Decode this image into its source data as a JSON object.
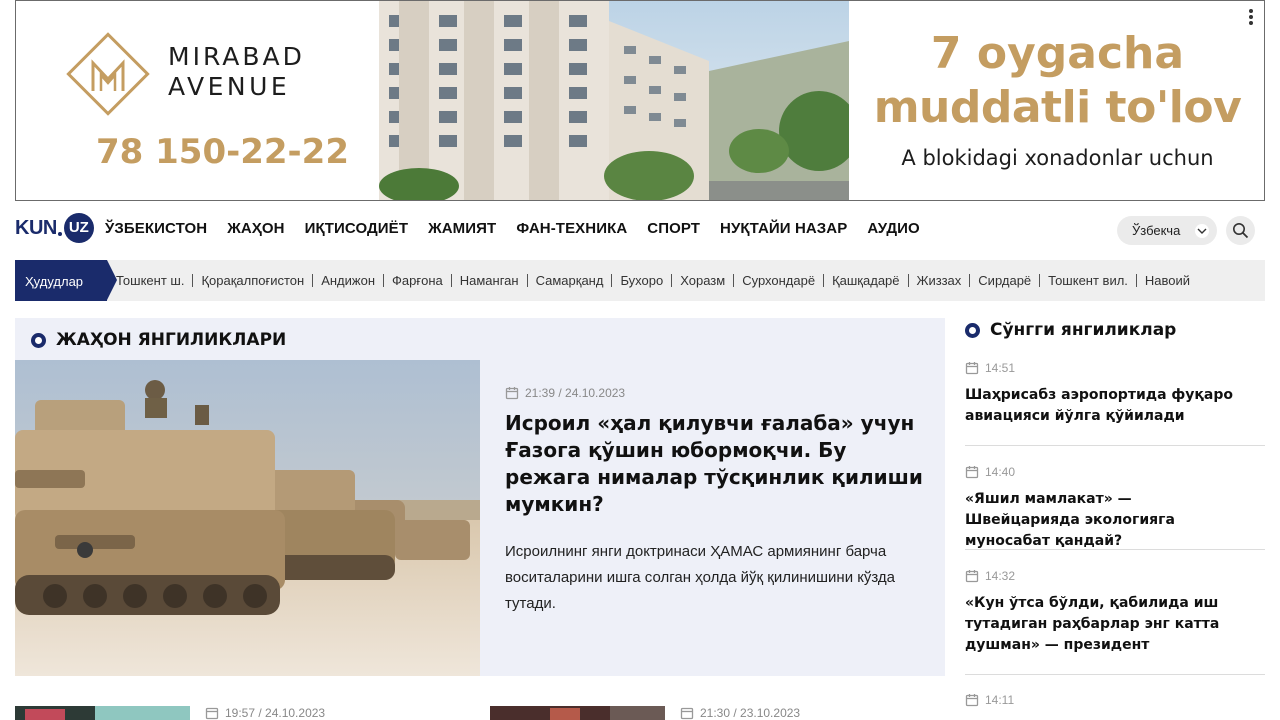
{
  "banner": {
    "brand_line1": "MIRABAD",
    "brand_line2": "AVENUE",
    "phone": "78 150-22-22",
    "promo_line1": "7 oygacha",
    "promo_line2": "muddatli to'lov",
    "promo_line3": "A blokidagi xonadonlar uchun"
  },
  "header": {
    "logo_kun": "KUN",
    "logo_uz": "UZ",
    "nav": [
      "ЎЗБЕКИСТОН",
      "ЖАҲОН",
      "ИҚТИСОДИЁТ",
      "ЖАМИЯТ",
      "ФАН-ТЕХНИКА",
      "СПОРТ",
      "НУҚТАЙИ НАЗАР",
      "АУДИО"
    ],
    "language": "Ўзбекча"
  },
  "regions": {
    "tab_label": "Ҳудудлар",
    "items": [
      "Тошкент ш.",
      "Қорақалпоғистон",
      "Андижон",
      "Фарғона",
      "Наманган",
      "Самарқанд",
      "Бухоро",
      "Хоразм",
      "Сурхондарё",
      "Қашқадарё",
      "Жиззах",
      "Сирдарё",
      "Тошкент вил.",
      "Навоий"
    ]
  },
  "world": {
    "heading": "ЖАҲОН ЯНГИЛИКЛАРИ",
    "featured": {
      "datetime": "21:39 / 24.10.2023",
      "title": "Исроил «ҳал қилувчи ғалаба» учун Ғазога қўшин юбормоқчи. Бу режага нималар тўсқинлик қилиши мумкин?",
      "excerpt": "Исроилнинг янги доктринаси ҲАМАС армиянинг барча воситаларини ишга солган ҳолда йўқ қилинишини кўзда тутади."
    },
    "cards": [
      {
        "datetime": "19:57 / 24.10.2023"
      },
      {
        "datetime": "21:30 / 23.10.2023"
      }
    ]
  },
  "latest": {
    "heading": "Сўнгги янгиликлар",
    "items": [
      {
        "time": "14:51",
        "title": "Шаҳрисабз аэропортида фуқаро авиацияси йўлга қўйилади"
      },
      {
        "time": "14:40",
        "title": "«Яшил мамлакат» — Швейцарияда экологияга муносабат қандай?"
      },
      {
        "time": "14:32",
        "title": "«Кун ўтса бўлди, қабилида иш тутадиган раҳбарлар энг катта душман» — президент"
      },
      {
        "time": "14:11",
        "title": ""
      }
    ]
  },
  "colors": {
    "brand_navy": "#1a2b6b",
    "banner_gold": "#c49d61",
    "section_bg": "#eef0f8",
    "region_bar_bg": "#efefef"
  },
  "icons": [
    "dots-menu-icon",
    "chevron-down-icon",
    "search-icon",
    "calendar-icon",
    "section-ring-icon"
  ]
}
